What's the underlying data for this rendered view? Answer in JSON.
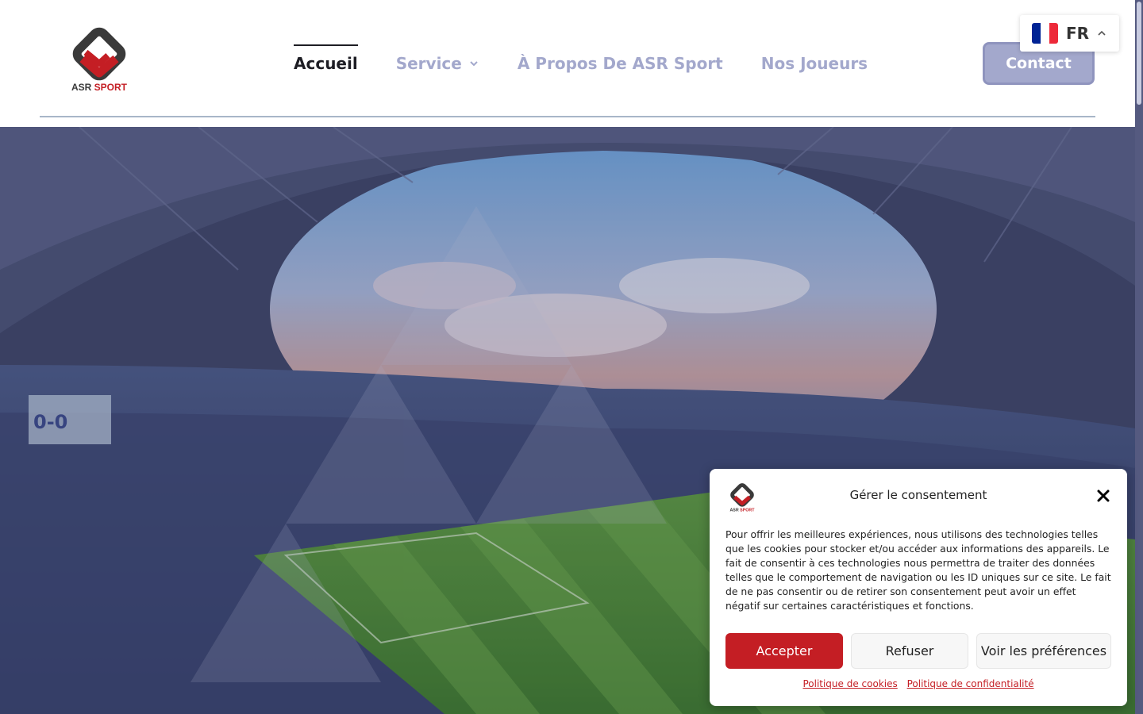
{
  "brand": {
    "logo_text": "ASR SPORT"
  },
  "nav": {
    "items": [
      {
        "label": "Accueil",
        "active": true
      },
      {
        "label": "Service",
        "dropdown": true
      },
      {
        "label": "À Propos De ASR Sport"
      },
      {
        "label": "Nos Joueurs"
      }
    ],
    "contact_label": "Contact"
  },
  "language": {
    "code": "FR",
    "flag_colors": [
      "#002395",
      "#ffffff",
      "#ed2939"
    ]
  },
  "consent": {
    "title": "Gérer le consentement",
    "body": "Pour offrir les meilleures expériences, nous utilisons des technologies telles que les cookies pour stocker et/ou accéder aux informations des appareils. Le fait de consentir à ces technologies nous permettra de traiter des données telles que le comportement de navigation ou les ID uniques sur ce site. Le fait de ne pas consentir ou de retirer son consentement peut avoir un effet négatif sur certaines caractéristiques et fonctions.",
    "accept_label": "Accepter",
    "refuse_label": "Refuser",
    "prefs_label": "Voir les préférences",
    "cookie_policy_label": "Politique de cookies",
    "privacy_policy_label": "Politique de confidentialité"
  },
  "colors": {
    "accent_red": "#c41e24",
    "nav_muted": "#a3a8cc",
    "nav_active": "#1d1d24"
  },
  "hero": {
    "image": "stadium-photo"
  }
}
